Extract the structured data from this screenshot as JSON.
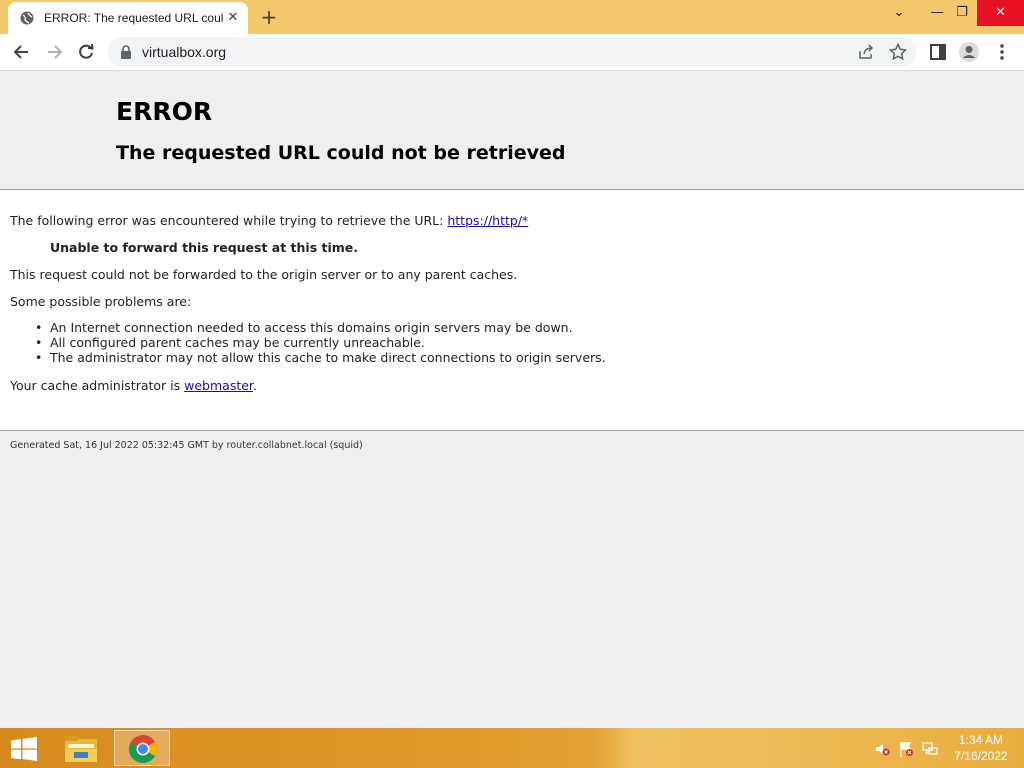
{
  "browser": {
    "tab_title": "ERROR: The requested URL could not be retrieved",
    "new_tab_symbol": "+",
    "close_tab_symbol": "✕",
    "url": "virtualbox.org",
    "window_controls": {
      "dropdown": "⌄",
      "minimize": "—",
      "restore": "❐",
      "close": "✕"
    }
  },
  "page": {
    "title": "ERROR",
    "subtitle": "The requested URL could not be retrieved",
    "intro_text": "The following error was encountered while trying to retrieve the URL:",
    "intro_link": "https://http/*",
    "error_message": "Unable to forward this request at this time.",
    "explanation": "This request could not be forwarded to the origin server or to any parent caches.",
    "problems_heading": "Some possible problems are:",
    "problems": [
      "An Internet connection needed to access this domains origin servers may be down.",
      "All configured parent caches may be currently unreachable.",
      "The administrator may not allow this cache to make direct connections to origin servers."
    ],
    "admin_text": "Your cache administrator is",
    "admin_link": "webmaster",
    "admin_suffix": ".",
    "footer": "Generated Sat, 16 Jul 2022 05:32:45 GMT by router.collabnet.local (squid)"
  },
  "taskbar": {
    "time": "1:34 AM",
    "date": "7/16/2022"
  },
  "colors": {
    "tabstrip": "#f3c86a",
    "link": "#1a0dab",
    "close_button": "#e81123"
  }
}
